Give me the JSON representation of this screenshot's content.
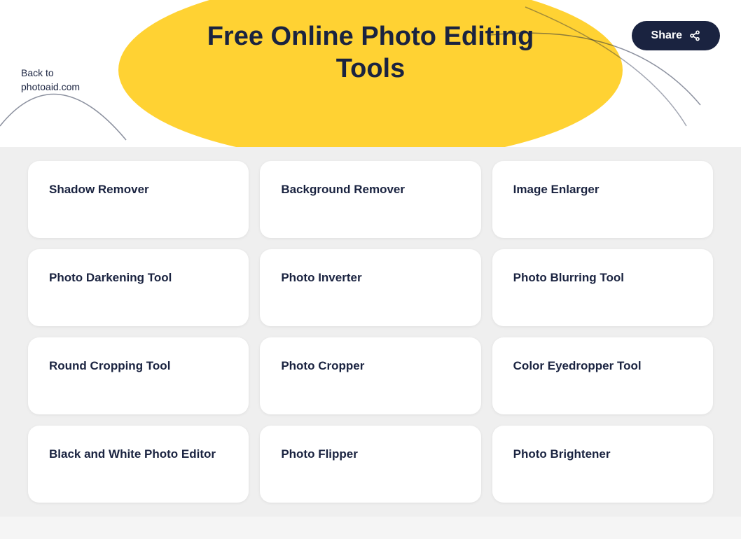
{
  "header": {
    "back_label": "Back to\nphotoaid.com",
    "title_line1": "Free Online Photo Editing",
    "title_line2": "Tools",
    "share_label": "Share"
  },
  "tools": [
    {
      "label": "Shadow Remover"
    },
    {
      "label": "Background Remover"
    },
    {
      "label": "Image Enlarger"
    },
    {
      "label": "Photo Darkening Tool"
    },
    {
      "label": "Photo Inverter"
    },
    {
      "label": "Photo Blurring Tool"
    },
    {
      "label": "Round Cropping Tool"
    },
    {
      "label": "Photo Cropper"
    },
    {
      "label": "Color Eyedropper Tool"
    },
    {
      "label": "Black and White Photo Editor"
    },
    {
      "label": "Photo Flipper"
    },
    {
      "label": "Photo Brightener"
    }
  ],
  "colors": {
    "yellow": "#FFD233",
    "dark_navy": "#1a2340"
  }
}
